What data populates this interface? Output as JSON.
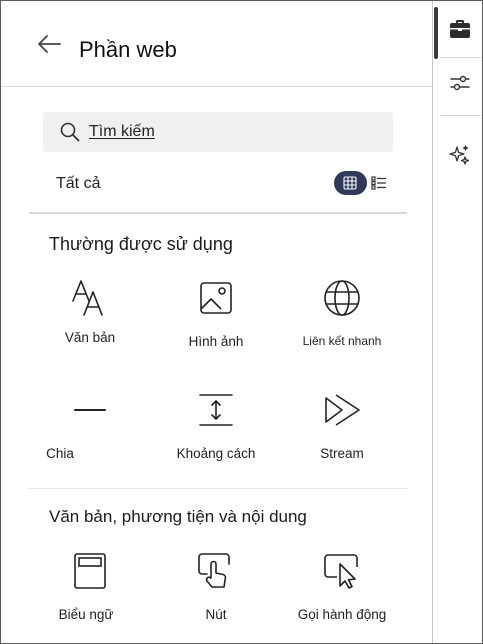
{
  "panel": {
    "title": "Phần web",
    "search_placeholder": "Tìm kiếm",
    "filter_label": "Tất cả"
  },
  "sections": [
    {
      "title": "Thường được sử dụng",
      "items": [
        {
          "label": "Văn bản",
          "icon": "text-icon"
        },
        {
          "label": "Hình ảnh",
          "icon": "image-icon"
        },
        {
          "label": "Liên kết nhanh",
          "icon": "globe-icon"
        },
        {
          "label": "Chia",
          "icon": "divider-icon"
        },
        {
          "label": "Khoảng cách",
          "icon": "spacer-icon"
        },
        {
          "label": "Stream",
          "icon": "stream-icon"
        }
      ]
    },
    {
      "title": "Văn bản, phương tiện và nội dung",
      "items": [
        {
          "label": "Biểu ngữ",
          "icon": "banner-icon"
        },
        {
          "label": "Nút",
          "icon": "button-tap-icon"
        },
        {
          "label": "Gọi hành động",
          "icon": "call-to-action-icon"
        }
      ]
    }
  ],
  "rail": {
    "items": [
      "toolbox-icon",
      "settings-sliders-icon",
      "sparkle-icon"
    ]
  },
  "colors": {
    "toggle_active": "#2f3a58",
    "search_bg": "#f0f0f0"
  }
}
